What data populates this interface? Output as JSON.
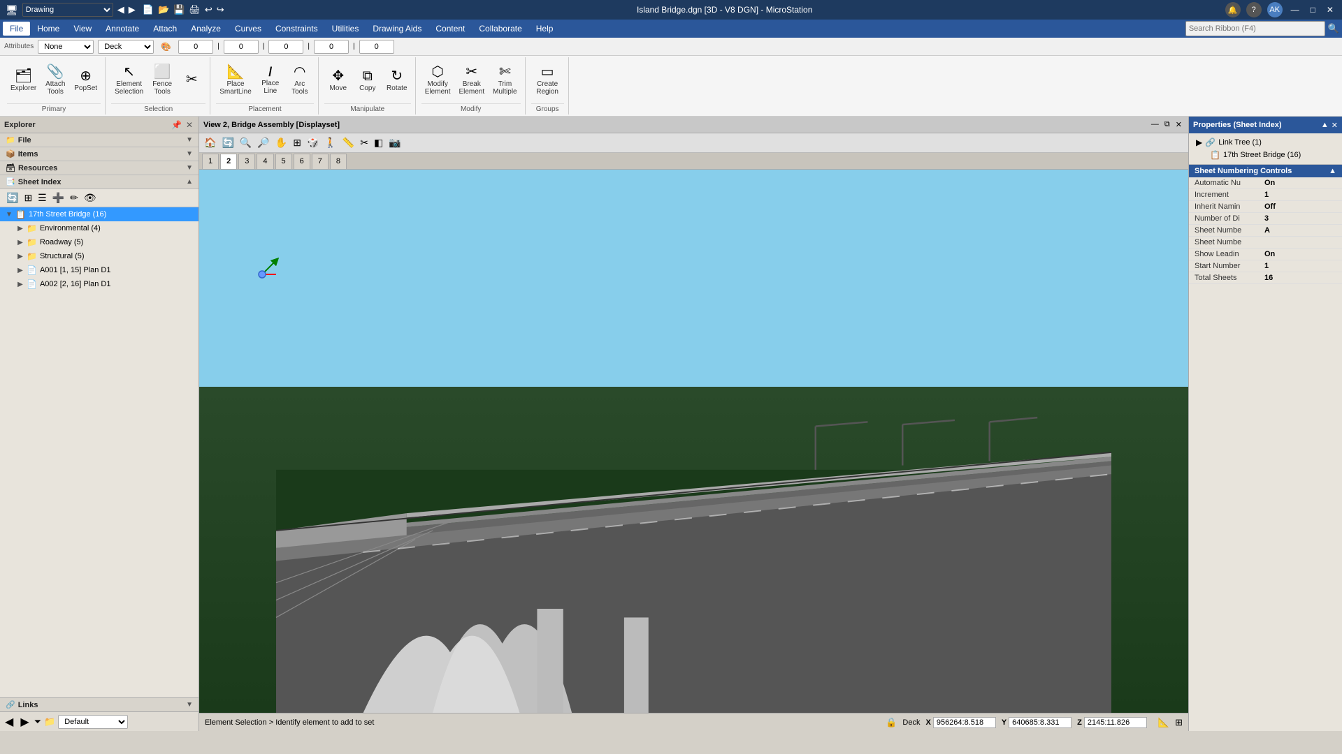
{
  "app": {
    "title": "Island Bridge.dgn [3D - V8 DGN] - MicroStation",
    "window_type": "Drawing"
  },
  "titlebar": {
    "left_label": "Drawing",
    "center": "Island Bridge.dgn [3D - V8 DGN] - MicroStation",
    "search_placeholder": "Search Ribbon (F4)",
    "min": "—",
    "max": "□",
    "close": "✕",
    "user": "AK"
  },
  "menubar": {
    "items": [
      "File",
      "Home",
      "View",
      "Annotate",
      "Attach",
      "Analyze",
      "Curves",
      "Constraints",
      "Utilities",
      "Drawing Aids",
      "Content",
      "Collaborate",
      "Help"
    ]
  },
  "ribbon": {
    "attributes": {
      "level1": "None",
      "level2": "Deck",
      "inputs": [
        "0",
        "0",
        "0",
        "0",
        "0"
      ]
    },
    "groups": [
      {
        "label": "Primary",
        "buttons": [
          {
            "label": "Explorer",
            "icon": "🗂"
          },
          {
            "label": "Attach\nTools",
            "icon": "📎"
          },
          {
            "label": "PopSet",
            "icon": "⊕"
          }
        ]
      },
      {
        "label": "Selection",
        "buttons": [
          {
            "label": "Element\nSelection",
            "icon": "↖"
          },
          {
            "label": "Fence\nTools",
            "icon": "⬜"
          },
          {
            "label": "",
            "icon": "✂"
          }
        ]
      },
      {
        "label": "Placement",
        "buttons": [
          {
            "label": "Place\nSmartLine",
            "icon": "📐"
          },
          {
            "label": "Place\nLine",
            "icon": "/"
          },
          {
            "label": "Arc\nTools",
            "icon": "◠"
          }
        ]
      },
      {
        "label": "Manipulate",
        "buttons": [
          {
            "label": "Move",
            "icon": "✥"
          },
          {
            "label": "Copy",
            "icon": "⧉"
          },
          {
            "label": "Rotate",
            "icon": "↻"
          }
        ]
      },
      {
        "label": "Modify",
        "buttons": [
          {
            "label": "Modify\nElement",
            "icon": "⬡"
          },
          {
            "label": "Break\nElement",
            "icon": "✂"
          },
          {
            "label": "Trim\nMultiple",
            "icon": "✄"
          }
        ]
      },
      {
        "label": "Groups",
        "buttons": [
          {
            "label": "Create\nRegion",
            "icon": "▭"
          }
        ]
      }
    ]
  },
  "explorer": {
    "title": "Explorer",
    "sections": [
      {
        "name": "File",
        "expanded": false
      },
      {
        "name": "Items",
        "expanded": false
      },
      {
        "name": "Resources",
        "expanded": false
      },
      {
        "name": "Sheet Index",
        "expanded": true,
        "tree": [
          {
            "label": "17th Street Bridge (16)",
            "icon": "📋",
            "selected": true,
            "children": [
              {
                "label": "Environmental (4)",
                "icon": "📁",
                "expanded": false
              },
              {
                "label": "Roadway (5)",
                "icon": "📁",
                "expanded": false
              },
              {
                "label": "Structural (5)",
                "icon": "📁",
                "expanded": false
              },
              {
                "label": "A001 [1, 15] Plan D1",
                "icon": "📄",
                "expanded": false
              },
              {
                "label": "A002 [2, 16] Plan D1",
                "icon": "📄",
                "expanded": false
              }
            ]
          }
        ]
      }
    ],
    "links": "Links"
  },
  "navbar": {
    "back_icon": "◀",
    "forward_icon": "▶",
    "level": "Default"
  },
  "view": {
    "title": "View 2, Bridge Assembly [Displayset]",
    "tabs": [
      "1",
      "2",
      "3",
      "4",
      "5",
      "6",
      "7",
      "8"
    ]
  },
  "coordinates": {
    "x_label": "X",
    "x_value": "956264:8.518",
    "y_label": "Y",
    "y_value": "640685:8.331",
    "z_label": "Z",
    "z_value": "2145:11.826"
  },
  "statusbar": {
    "message": "Element Selection > Identify element to add to set",
    "level": "Deck"
  },
  "properties": {
    "title": "Properties (Sheet Index)",
    "link_tree": {
      "label": "Link Tree (1)",
      "children": [
        {
          "label": "17th Street Bridge (16)"
        }
      ]
    },
    "sheet_numbering": {
      "title": "Sheet Numbering Controls",
      "rows": [
        {
          "name": "Automatic Nu",
          "value": "On"
        },
        {
          "name": "Increment",
          "value": "1"
        },
        {
          "name": "Inherit Namin",
          "value": "Off"
        },
        {
          "name": "Number of Di",
          "value": "3"
        },
        {
          "name": "Sheet Numbe",
          "value": "A"
        },
        {
          "name": "Sheet Numbe",
          "value": ""
        },
        {
          "name": "Show Leadin",
          "value": "On"
        },
        {
          "name": "Start Number",
          "value": "1"
        },
        {
          "name": "Total Sheets",
          "value": "16"
        }
      ]
    }
  }
}
